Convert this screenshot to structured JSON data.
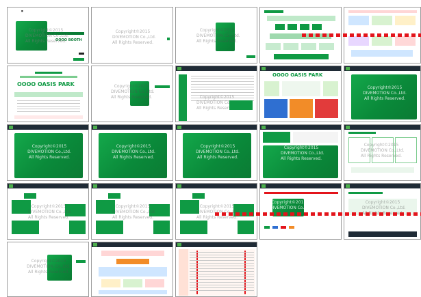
{
  "copyright": {
    "line1": "Copyright©2015",
    "line2": "DIVEMOTION Co.,Ltd.",
    "line3": "All Rights Reserved."
  },
  "banner": {
    "oasis_park": "OOOO OASIS PARK",
    "booth": "OOOO BOOTH"
  },
  "colors": {
    "brand_green": "#0f9a44",
    "header_dark": "#1f2b36",
    "dotted_red": "#e3141b",
    "orange": "#f28c28",
    "blue": "#2f6fd1"
  }
}
